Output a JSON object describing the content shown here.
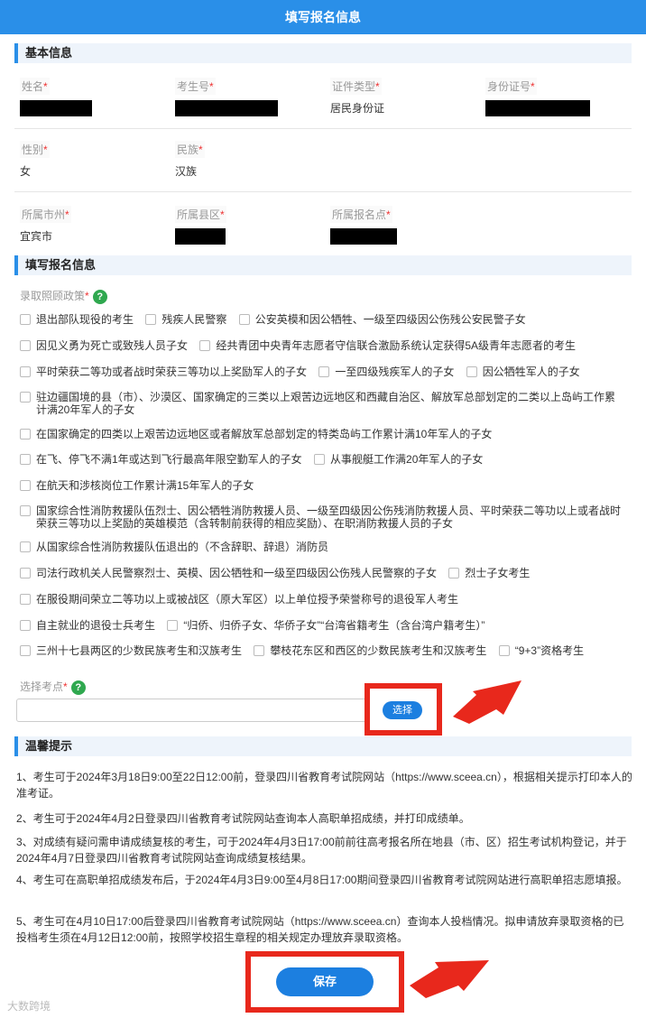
{
  "header": {
    "title": "填写报名信息"
  },
  "basic": {
    "section_title": "基本信息",
    "name": {
      "label": "姓名",
      "req": "*"
    },
    "exam_no": {
      "label": "考生号",
      "req": "*"
    },
    "id_type": {
      "label": "证件类型",
      "req": "*",
      "value": "居民身份证"
    },
    "id_no": {
      "label": "身份证号",
      "req": "*"
    },
    "gender": {
      "label": "性别",
      "req": "*",
      "value": "女"
    },
    "ethnicity": {
      "label": "民族",
      "req": "*",
      "value": "汉族"
    },
    "city": {
      "label": "所属市州",
      "req": "*",
      "value": "宜宾市"
    },
    "county": {
      "label": "所属县区",
      "req": "*"
    },
    "site": {
      "label": "所属报名点",
      "req": "*"
    }
  },
  "apply": {
    "section_title": "填写报名信息",
    "policy_label": "录取照顾政策",
    "req": "*",
    "help": "?",
    "options": [
      "退出部队现役的考生",
      "残疾人民警察",
      "公安英模和因公牺牲、一级至四级因公伤残公安民警子女",
      "因见义勇为死亡或致残人员子女",
      "经共青团中央青年志愿者守信联合激励系统认定获得5A级青年志愿者的考生",
      "平时荣获二等功或者战时荣获三等功以上奖励军人的子女",
      "一至四级残疾军人的子女",
      "因公牺牲军人的子女",
      "驻边疆国境的县（市）、沙漠区、国家确定的三类以上艰苦边远地区和西藏自治区、解放军总部划定的二类以上岛屿工作累计满20年军人的子女",
      "在国家确定的四类以上艰苦边远地区或者解放军总部划定的特类岛屿工作累计满10年军人的子女",
      "在飞、停飞不满1年或达到飞行最高年限空勤军人的子女",
      "从事舰艇工作满20年军人的子女",
      "在航天和涉核岗位工作累计满15年军人的子女",
      "国家综合性消防救援队伍烈士、因公牺牲消防救援人员、一级至四级因公伤残消防救援人员、平时荣获二等功以上或者战时荣获三等功以上奖励的英雄模范（含转制前获得的相应奖励）、在职消防救援人员的子女",
      "从国家综合性消防救援队伍退出的（不含辞职、辞退）消防员",
      "司法行政机关人民警察烈士、英模、因公牺牲和一级至四级因公伤残人民警察的子女",
      "烈士子女考生",
      "在服役期间荣立二等功以上或被战区（原大军区）以上单位授予荣誉称号的退役军人考生",
      "自主就业的退役士兵考生",
      "“归侨、归侨子女、华侨子女”“台湾省籍考生（含台湾户籍考生）”",
      "三州十七县两区的少数民族考生和汉族考生",
      "攀枝花东区和西区的少数民族考生和汉族考生",
      "“9+3”资格考生"
    ],
    "site_label": "选择考点",
    "select_button": "选择"
  },
  "tips": {
    "section_title": "温馨提示",
    "items": [
      "1、考生可于2024年3月18日9:00至22日12:00前，登录四川省教育考试院网站（https://www.sceea.cn），根据相关提示打印本人的准考证。",
      "2、考生可于2024年4月2日登录四川省教育考试院网站查询本人高职单招成绩，并打印成绩单。",
      "3、对成绩有疑问需申请成绩复核的考生，可于2024年4月3日17:00前前往高考报名所在地县（市、区）招生考试机构登记，并于2024年4月7日登录四川省教育考试院网站查询成绩复核结果。",
      "4、考生可在高职单招成绩发布后，于2024年4月3日9:00至4月8日17:00期间登录四川省教育考试院网站进行高职单招志愿填报。",
      "5、考生可在4月10日17:00后登录四川省教育考试院网站（https://www.sceea.cn）查询本人投档情况。拟申请放弃录取资格的已投档考生须在4月12日12:00前，按照学校招生章程的相关规定办理放弃录取资格。"
    ]
  },
  "save_button": "保存",
  "watermark": "大数跨境",
  "colors": {
    "accent": "#2a8fe8",
    "button": "#1c7fe0",
    "highlight": "#e8281c",
    "required": "#e33333",
    "help": "#2fa84f"
  }
}
